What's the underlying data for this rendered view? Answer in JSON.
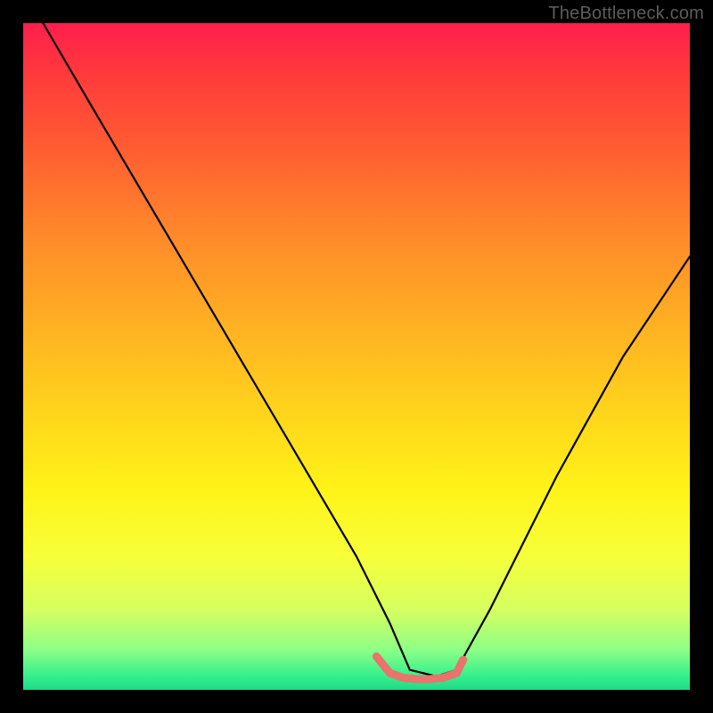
{
  "attribution": "TheBottleneck.com",
  "chart_data": {
    "type": "line",
    "title": "",
    "xlabel": "",
    "ylabel": "",
    "xlim": [
      0,
      100
    ],
    "ylim": [
      0,
      100
    ],
    "series": [
      {
        "name": "main-curve",
        "color": "#000000",
        "x": [
          3,
          10,
          20,
          30,
          40,
          50,
          55,
          58,
          62,
          65,
          70,
          80,
          90,
          100
        ],
        "y": [
          100,
          88,
          71,
          54,
          37,
          20,
          10,
          3,
          2,
          3,
          12,
          32,
          50,
          65
        ]
      },
      {
        "name": "highlight-segment",
        "color": "#e8746c",
        "x": [
          53,
          55,
          57,
          59,
          61,
          63,
          65,
          66
        ],
        "y": [
          5,
          2.5,
          1.8,
          1.6,
          1.6,
          1.8,
          2.5,
          4.5
        ]
      }
    ],
    "background_gradient": {
      "top": "#ff1e4d",
      "mid": "#ffd31c",
      "bottom": "#20d988"
    }
  }
}
